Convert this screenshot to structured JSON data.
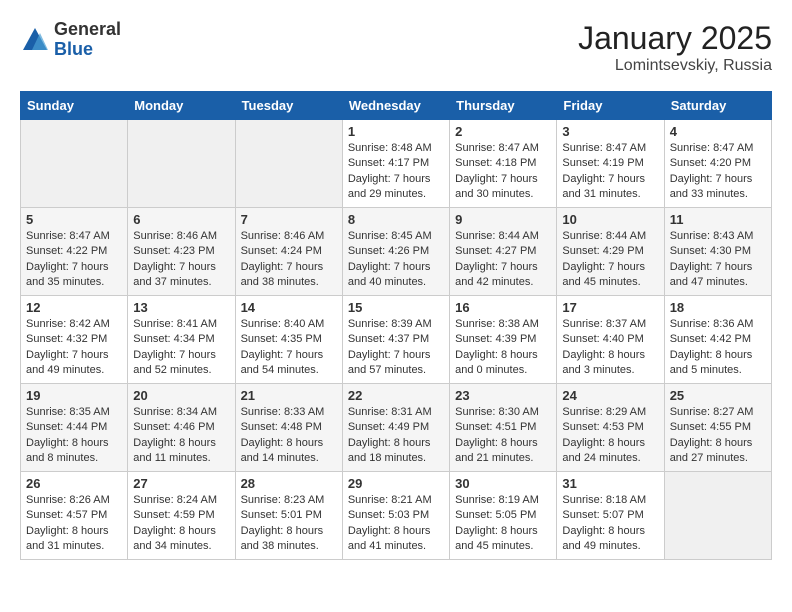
{
  "logo": {
    "general": "General",
    "blue": "Blue"
  },
  "title": "January 2025",
  "location": "Lomintsevskiy, Russia",
  "days_header": [
    "Sunday",
    "Monday",
    "Tuesday",
    "Wednesday",
    "Thursday",
    "Friday",
    "Saturday"
  ],
  "weeks": [
    [
      {
        "day": "",
        "content": ""
      },
      {
        "day": "",
        "content": ""
      },
      {
        "day": "",
        "content": ""
      },
      {
        "day": "1",
        "content": "Sunrise: 8:48 AM\nSunset: 4:17 PM\nDaylight: 7 hours\nand 29 minutes."
      },
      {
        "day": "2",
        "content": "Sunrise: 8:47 AM\nSunset: 4:18 PM\nDaylight: 7 hours\nand 30 minutes."
      },
      {
        "day": "3",
        "content": "Sunrise: 8:47 AM\nSunset: 4:19 PM\nDaylight: 7 hours\nand 31 minutes."
      },
      {
        "day": "4",
        "content": "Sunrise: 8:47 AM\nSunset: 4:20 PM\nDaylight: 7 hours\nand 33 minutes."
      }
    ],
    [
      {
        "day": "5",
        "content": "Sunrise: 8:47 AM\nSunset: 4:22 PM\nDaylight: 7 hours\nand 35 minutes."
      },
      {
        "day": "6",
        "content": "Sunrise: 8:46 AM\nSunset: 4:23 PM\nDaylight: 7 hours\nand 37 minutes."
      },
      {
        "day": "7",
        "content": "Sunrise: 8:46 AM\nSunset: 4:24 PM\nDaylight: 7 hours\nand 38 minutes."
      },
      {
        "day": "8",
        "content": "Sunrise: 8:45 AM\nSunset: 4:26 PM\nDaylight: 7 hours\nand 40 minutes."
      },
      {
        "day": "9",
        "content": "Sunrise: 8:44 AM\nSunset: 4:27 PM\nDaylight: 7 hours\nand 42 minutes."
      },
      {
        "day": "10",
        "content": "Sunrise: 8:44 AM\nSunset: 4:29 PM\nDaylight: 7 hours\nand 45 minutes."
      },
      {
        "day": "11",
        "content": "Sunrise: 8:43 AM\nSunset: 4:30 PM\nDaylight: 7 hours\nand 47 minutes."
      }
    ],
    [
      {
        "day": "12",
        "content": "Sunrise: 8:42 AM\nSunset: 4:32 PM\nDaylight: 7 hours\nand 49 minutes."
      },
      {
        "day": "13",
        "content": "Sunrise: 8:41 AM\nSunset: 4:34 PM\nDaylight: 7 hours\nand 52 minutes."
      },
      {
        "day": "14",
        "content": "Sunrise: 8:40 AM\nSunset: 4:35 PM\nDaylight: 7 hours\nand 54 minutes."
      },
      {
        "day": "15",
        "content": "Sunrise: 8:39 AM\nSunset: 4:37 PM\nDaylight: 7 hours\nand 57 minutes."
      },
      {
        "day": "16",
        "content": "Sunrise: 8:38 AM\nSunset: 4:39 PM\nDaylight: 8 hours\nand 0 minutes."
      },
      {
        "day": "17",
        "content": "Sunrise: 8:37 AM\nSunset: 4:40 PM\nDaylight: 8 hours\nand 3 minutes."
      },
      {
        "day": "18",
        "content": "Sunrise: 8:36 AM\nSunset: 4:42 PM\nDaylight: 8 hours\nand 5 minutes."
      }
    ],
    [
      {
        "day": "19",
        "content": "Sunrise: 8:35 AM\nSunset: 4:44 PM\nDaylight: 8 hours\nand 8 minutes."
      },
      {
        "day": "20",
        "content": "Sunrise: 8:34 AM\nSunset: 4:46 PM\nDaylight: 8 hours\nand 11 minutes."
      },
      {
        "day": "21",
        "content": "Sunrise: 8:33 AM\nSunset: 4:48 PM\nDaylight: 8 hours\nand 14 minutes."
      },
      {
        "day": "22",
        "content": "Sunrise: 8:31 AM\nSunset: 4:49 PM\nDaylight: 8 hours\nand 18 minutes."
      },
      {
        "day": "23",
        "content": "Sunrise: 8:30 AM\nSunset: 4:51 PM\nDaylight: 8 hours\nand 21 minutes."
      },
      {
        "day": "24",
        "content": "Sunrise: 8:29 AM\nSunset: 4:53 PM\nDaylight: 8 hours\nand 24 minutes."
      },
      {
        "day": "25",
        "content": "Sunrise: 8:27 AM\nSunset: 4:55 PM\nDaylight: 8 hours\nand 27 minutes."
      }
    ],
    [
      {
        "day": "26",
        "content": "Sunrise: 8:26 AM\nSunset: 4:57 PM\nDaylight: 8 hours\nand 31 minutes."
      },
      {
        "day": "27",
        "content": "Sunrise: 8:24 AM\nSunset: 4:59 PM\nDaylight: 8 hours\nand 34 minutes."
      },
      {
        "day": "28",
        "content": "Sunrise: 8:23 AM\nSunset: 5:01 PM\nDaylight: 8 hours\nand 38 minutes."
      },
      {
        "day": "29",
        "content": "Sunrise: 8:21 AM\nSunset: 5:03 PM\nDaylight: 8 hours\nand 41 minutes."
      },
      {
        "day": "30",
        "content": "Sunrise: 8:19 AM\nSunset: 5:05 PM\nDaylight: 8 hours\nand 45 minutes."
      },
      {
        "day": "31",
        "content": "Sunrise: 8:18 AM\nSunset: 5:07 PM\nDaylight: 8 hours\nand 49 minutes."
      },
      {
        "day": "",
        "content": ""
      }
    ]
  ]
}
